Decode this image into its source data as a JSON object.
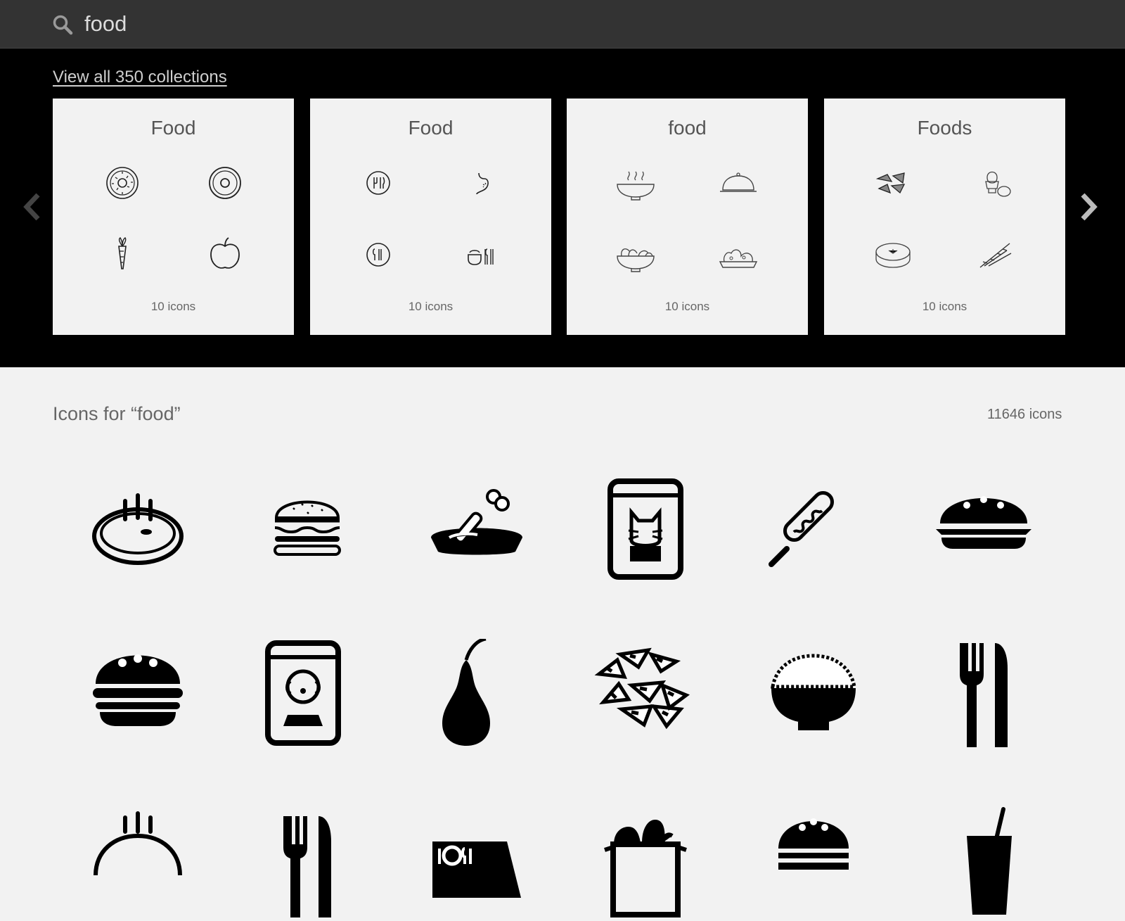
{
  "search": {
    "query": "food",
    "icon": "search-icon"
  },
  "collections": {
    "view_all_label": "View all 350 collections",
    "prev_icon": "chevron-left-icon",
    "next_icon": "chevron-right-icon",
    "cards": [
      {
        "title": "Food",
        "count": "10 icons",
        "icons": [
          "donut-icon",
          "donut-icon",
          "carrot-icon",
          "apple-icon"
        ]
      },
      {
        "title": "Food",
        "count": "10 icons",
        "icons": [
          "plate-cutlery-icon",
          "stomach-icon",
          "plate-cutlery-icon",
          "bowl-cutlery-icon"
        ]
      },
      {
        "title": "food",
        "count": "10 icons",
        "icons": [
          "hot-soup-icon",
          "food-cloche-icon",
          "salad-bowl-icon",
          "vegetable-plate-icon"
        ]
      },
      {
        "title": "Foods",
        "count": "10 icons",
        "icons": [
          "nachos-icon",
          "boiled-egg-icon",
          "pie-icon",
          "herbs-icon"
        ]
      }
    ]
  },
  "results": {
    "title": "Icons for “food”",
    "count": "11646 icons",
    "icons": [
      "hot-bowl-icon",
      "burger-icon",
      "dog-bowl-icon",
      "cat-food-bag-icon",
      "corn-dog-icon",
      "burger-icon",
      "burger-icon",
      "dog-food-bag-icon",
      "pear-icon",
      "nachos-icon",
      "rice-bowl-icon",
      "fork-knife-icon",
      "hot-dish-icon",
      "fork-knife-icon",
      "restaurant-sign-icon",
      "grocery-bag-icon",
      "burger-icon",
      "drink-cup-icon"
    ]
  }
}
